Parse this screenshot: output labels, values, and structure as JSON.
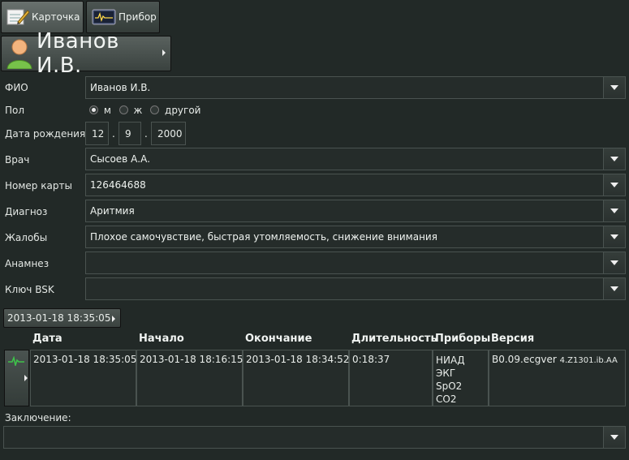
{
  "tabs": [
    {
      "label": "Карточка",
      "icon": "card-edit-icon",
      "active": true
    },
    {
      "label": "Прибор",
      "icon": "device-monitor-icon",
      "active": false
    }
  ],
  "patient": {
    "name": "Иванов И.В.",
    "icon": "person-icon"
  },
  "form": {
    "fio_label": "ФИО",
    "fio_value": "Иванов И.В.",
    "sex_label": "Пол",
    "sex_options": [
      "м",
      "ж",
      "другой"
    ],
    "sex_selected": "м",
    "dob_label": "Дата рождения",
    "dob_day": "12",
    "dob_month": "9",
    "dob_year": "2000",
    "dob_sep": ".",
    "doctor_label": "Врач",
    "doctor_value": "Сысоев А.А.",
    "card_label": "Номер карты",
    "card_value": "126464688",
    "diagnosis_label": "Диагноз",
    "diagnosis_value": "Аритмия",
    "complaints_label": "Жалобы",
    "complaints_value": "Плохое самочувствие, быстрая утомляемость, снижение внимания",
    "anamnesis_label": "Анамнез",
    "anamnesis_value": "",
    "bsk_label": "Ключ BSK",
    "bsk_value": ""
  },
  "session_button": "2013-01-18 18:35:05",
  "table": {
    "headers": [
      "Дата",
      "Начало",
      "Окончание",
      "Длительность",
      "Приборы",
      "Версия"
    ],
    "row": {
      "date": "2013-01-18 18:35:05",
      "start": "2013-01-18 18:16:15",
      "end": "2013-01-18 18:34:52",
      "duration": "0:18:37",
      "devices": [
        "НИАД",
        "ЭКГ",
        "SpO2",
        "CO2"
      ],
      "version_main": "B0.09.ecgver",
      "version_sub": "4.Z1301.ib.AA"
    }
  },
  "conclusion": {
    "label": "Заключение:",
    "value": ""
  },
  "colors": {
    "background": "#222927",
    "field": "#252c2a",
    "accent_green": "#3ec24a"
  }
}
